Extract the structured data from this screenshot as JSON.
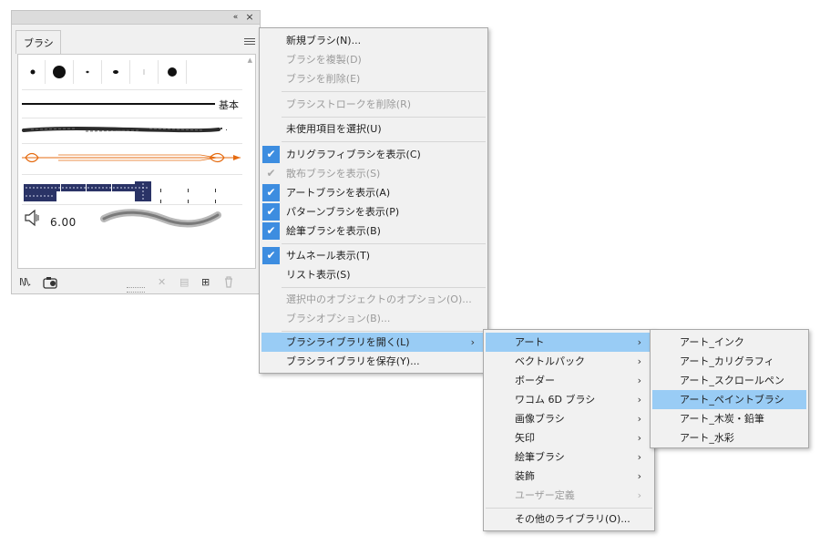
{
  "panel": {
    "collapse_glyph": "«",
    "close_glyph": "×",
    "tab_label": "ブラシ",
    "basic_label": "基本",
    "stroke_size": "6.00",
    "footer_icons": [
      "brush-libraries-menu-icon",
      "library-panel-icon",
      "remove-stroke-icon",
      "brush-options-icon",
      "new-brush-icon",
      "delete-brush-icon"
    ],
    "footer_glyphs": {
      "libraries": "I\\I\\.",
      "remove": "✕",
      "options": "▤",
      "new": "⊞",
      "delete": "🗑"
    },
    "colors": {
      "arrow_brush": "#e56b10",
      "pattern_brush": "#2a3366",
      "check_blue": "#3d8de0",
      "highlight": "#99ccf5"
    }
  },
  "menu": {
    "items": [
      {
        "label": "新規ブラシ(N)..."
      },
      {
        "label": "ブラシを複製(D)"
      },
      {
        "label": "ブラシを削除(E)"
      },
      {
        "label": "ブラシストロークを削除(R)"
      },
      {
        "label": "未使用項目を選択(U)"
      },
      {
        "label": "カリグラフィブラシを表示(C)",
        "checked": true
      },
      {
        "label": "散布ブラシを表示(S)",
        "checked": true
      },
      {
        "label": "アートブラシを表示(A)",
        "checked": true
      },
      {
        "label": "パターンブラシを表示(P)",
        "checked": true
      },
      {
        "label": "絵筆ブラシを表示(B)",
        "checked": true
      },
      {
        "label": "サムネール表示(T)",
        "checked": true
      },
      {
        "label": "リスト表示(S)"
      },
      {
        "label": "選択中のオブジェクトのオプション(O)..."
      },
      {
        "label": "ブラシオプション(B)..."
      },
      {
        "label": "ブラシライブラリを開く(L)"
      },
      {
        "label": "ブラシライブラリを保存(Y)..."
      }
    ],
    "check_glyph": "✔",
    "submenu_arrow": "›"
  },
  "submenu": {
    "items": [
      {
        "label": "アート"
      },
      {
        "label": "ベクトルパック"
      },
      {
        "label": "ボーダー"
      },
      {
        "label": "ワコム 6D ブラシ"
      },
      {
        "label": "画像ブラシ"
      },
      {
        "label": "矢印"
      },
      {
        "label": "絵筆ブラシ"
      },
      {
        "label": "装飾"
      },
      {
        "label": "ユーザー定義"
      },
      {
        "label": "その他のライブラリ(O)..."
      }
    ]
  },
  "submenu3": {
    "items": [
      {
        "label": "アート_インク"
      },
      {
        "label": "アート_カリグラフィ"
      },
      {
        "label": "アート_スクロールペン"
      },
      {
        "label": "アート_ペイントブラシ"
      },
      {
        "label": "アート_木炭・鉛筆"
      },
      {
        "label": "アート_水彩"
      }
    ]
  }
}
